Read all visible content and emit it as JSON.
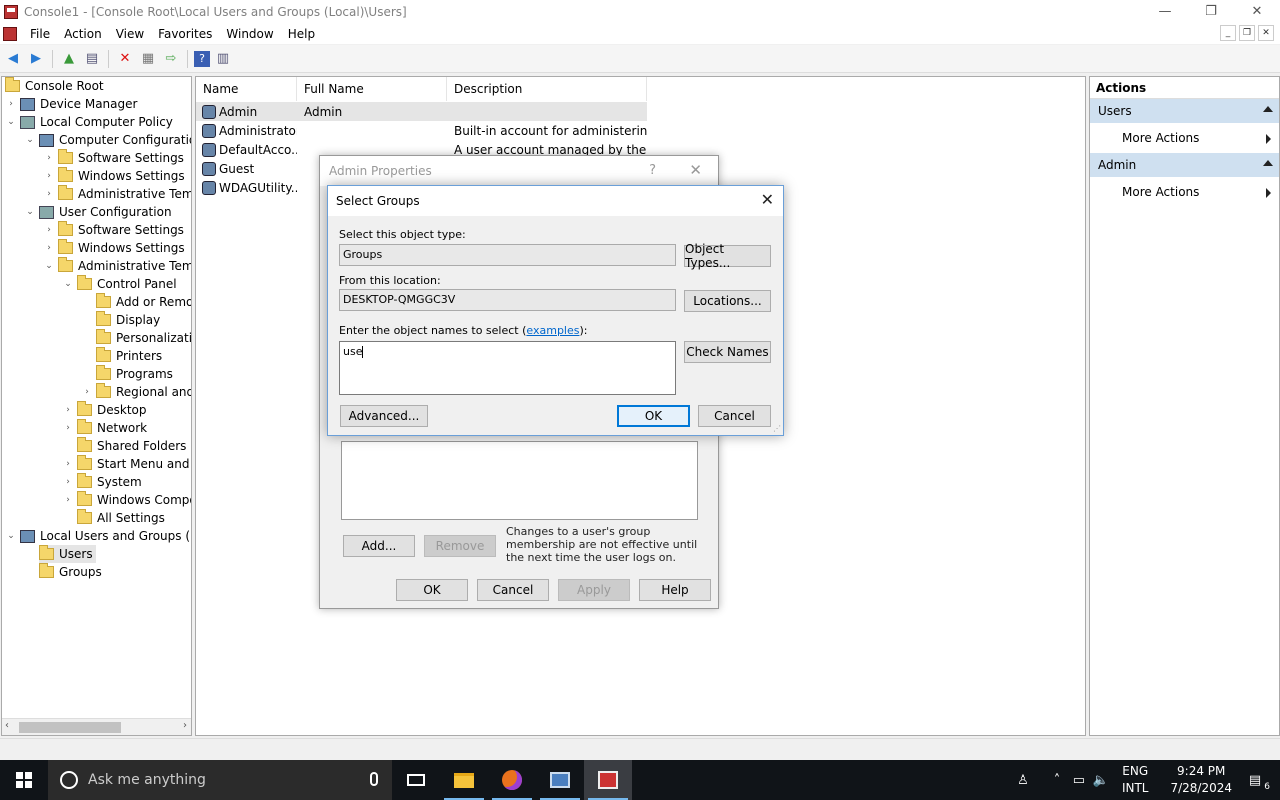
{
  "window": {
    "title": "Console1 - [Console Root\\Local Users and Groups (Local)\\Users]",
    "minimize": "—",
    "restore": "❐",
    "close": "✕"
  },
  "menu": [
    "File",
    "Action",
    "View",
    "Favorites",
    "Window",
    "Help"
  ],
  "tree": {
    "items": [
      {
        "label": "Console Root",
        "level": 0
      },
      {
        "label": "Device Manager",
        "level": 1
      },
      {
        "label": "Local Computer Policy",
        "level": 1
      },
      {
        "label": "Computer Configuration",
        "level": 2
      },
      {
        "label": "Software Settings",
        "level": 3
      },
      {
        "label": "Windows Settings",
        "level": 3
      },
      {
        "label": "Administrative Templates",
        "level": 3
      },
      {
        "label": "User Configuration",
        "level": 2
      },
      {
        "label": "Software Settings",
        "level": 3
      },
      {
        "label": "Windows Settings",
        "level": 3
      },
      {
        "label": "Administrative Templates",
        "level": 3
      },
      {
        "label": "Control Panel",
        "level": 4
      },
      {
        "label": "Add or Remove Programs",
        "level": 5
      },
      {
        "label": "Display",
        "level": 5
      },
      {
        "label": "Personalization",
        "level": 5
      },
      {
        "label": "Printers",
        "level": 5
      },
      {
        "label": "Programs",
        "level": 5
      },
      {
        "label": "Regional and Language Options",
        "level": 5
      },
      {
        "label": "Desktop",
        "level": 4
      },
      {
        "label": "Network",
        "level": 4
      },
      {
        "label": "Shared Folders",
        "level": 4
      },
      {
        "label": "Start Menu and Taskbar",
        "level": 4
      },
      {
        "label": "System",
        "level": 4
      },
      {
        "label": "Windows Components",
        "level": 4
      },
      {
        "label": "All Settings",
        "level": 4
      },
      {
        "label": "Local Users and Groups (Local)",
        "level": 1
      },
      {
        "label": "Users",
        "level": 2
      },
      {
        "label": "Groups",
        "level": 2
      }
    ]
  },
  "list": {
    "columns": [
      "Name",
      "Full Name",
      "Description"
    ],
    "rows": [
      {
        "name": "Admin",
        "full": "Admin",
        "desc": ""
      },
      {
        "name": "Administrator",
        "full": "",
        "desc": "Built-in account for administering..."
      },
      {
        "name": "DefaultAcco...",
        "full": "",
        "desc": "A user account managed by the s..."
      },
      {
        "name": "Guest",
        "full": "",
        "desc": ""
      },
      {
        "name": "WDAGUtility...",
        "full": "",
        "desc": ""
      }
    ]
  },
  "actions": {
    "header": "Actions",
    "sections": [
      {
        "title": "Users",
        "item": "More Actions"
      },
      {
        "title": "Admin",
        "item": "More Actions"
      }
    ]
  },
  "props_dialog": {
    "title": "Admin Properties",
    "help_glyph": "?",
    "close_glyph": "✕",
    "add": "Add...",
    "remove": "Remove",
    "note": "Changes to a user's group membership are not effective until the next time the user logs on.",
    "ok": "OK",
    "cancel": "Cancel",
    "apply": "Apply",
    "help": "Help"
  },
  "select_groups": {
    "title": "Select Groups",
    "close_glyph": "✕",
    "object_type_label": "Select this object type:",
    "object_type_value": "Groups",
    "object_types_button": "Object Types...",
    "location_label": "From this location:",
    "location_value": "DESKTOP-QMGGC3V",
    "locations_button": "Locations...",
    "names_label_prefix": "Enter the object names to select (",
    "names_label_link": "examples",
    "names_label_suffix": "):",
    "names_value": "use",
    "check_names_button": "Check Names",
    "advanced_button": "Advanced...",
    "ok_button": "OK",
    "cancel_button": "Cancel"
  },
  "taskbar": {
    "search_placeholder": "Ask me anything",
    "lang_top": "ENG",
    "lang_bottom": "INTL",
    "time": "9:24 PM",
    "date": "7/28/2024",
    "notifications": "6"
  }
}
